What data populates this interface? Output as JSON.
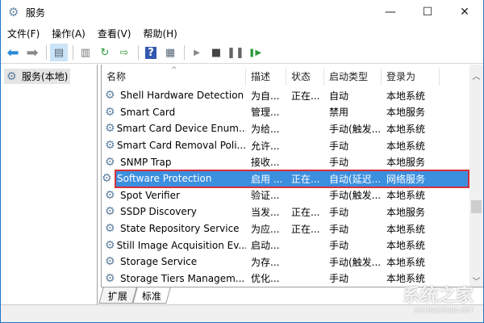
{
  "window": {
    "title": "服务",
    "minimize": "—",
    "maximize": "☐",
    "close": "✕"
  },
  "menu": [
    "文件(F)",
    "操作(A)",
    "查看(V)",
    "帮助(H)"
  ],
  "toolbar": [
    "back-icon",
    "forward-icon",
    "show-hide-tree-icon",
    "properties-icon",
    "refresh-icon",
    "export-icon",
    "help-icon",
    "console-icon",
    "start-icon",
    "stop-icon",
    "pause-icon",
    "resume-icon"
  ],
  "tree": {
    "root": "服务(本地)"
  },
  "table": {
    "columns": [
      "名称",
      "描述",
      "状态",
      "启动类型",
      "登录为"
    ],
    "rows": [
      [
        "Shell Hardware Detection",
        "为自...",
        "正在...",
        "自动",
        "本地系统"
      ],
      [
        "Smart Card",
        "管理...",
        "",
        "禁用",
        "本地服务"
      ],
      [
        "Smart Card Device Enum...",
        "为给...",
        "",
        "手动(触发...",
        "本地系统"
      ],
      [
        "Smart Card Removal Poli...",
        "允许...",
        "",
        "手动",
        "本地系统"
      ],
      [
        "SNMP Trap",
        "接收...",
        "",
        "手动",
        "本地服务"
      ],
      [
        "Software Protection",
        "启用 ...",
        "正在...",
        "自动(延迟...",
        "网络服务"
      ],
      [
        "Spot Verifier",
        "验证...",
        "",
        "手动(触发...",
        "本地系统"
      ],
      [
        "SSDP Discovery",
        "当发...",
        "正在...",
        "手动",
        "本地服务"
      ],
      [
        "State Repository Service",
        "为应...",
        "正在...",
        "手动",
        "本地系统"
      ],
      [
        "Still Image Acquisition Ev...",
        "启动...",
        "",
        "手动",
        "本地系统"
      ],
      [
        "Storage Service",
        "为存...",
        "",
        "手动(触发...",
        "本地系统"
      ],
      [
        "Storage Tiers Managem...",
        "优化...",
        "",
        "手动",
        "本地系统"
      ]
    ],
    "selected_index": 5
  },
  "tabs": [
    "扩展",
    "标准"
  ],
  "watermark": {
    "text": "系统之家",
    "sub": "XITONGZHIJIA.NET"
  }
}
